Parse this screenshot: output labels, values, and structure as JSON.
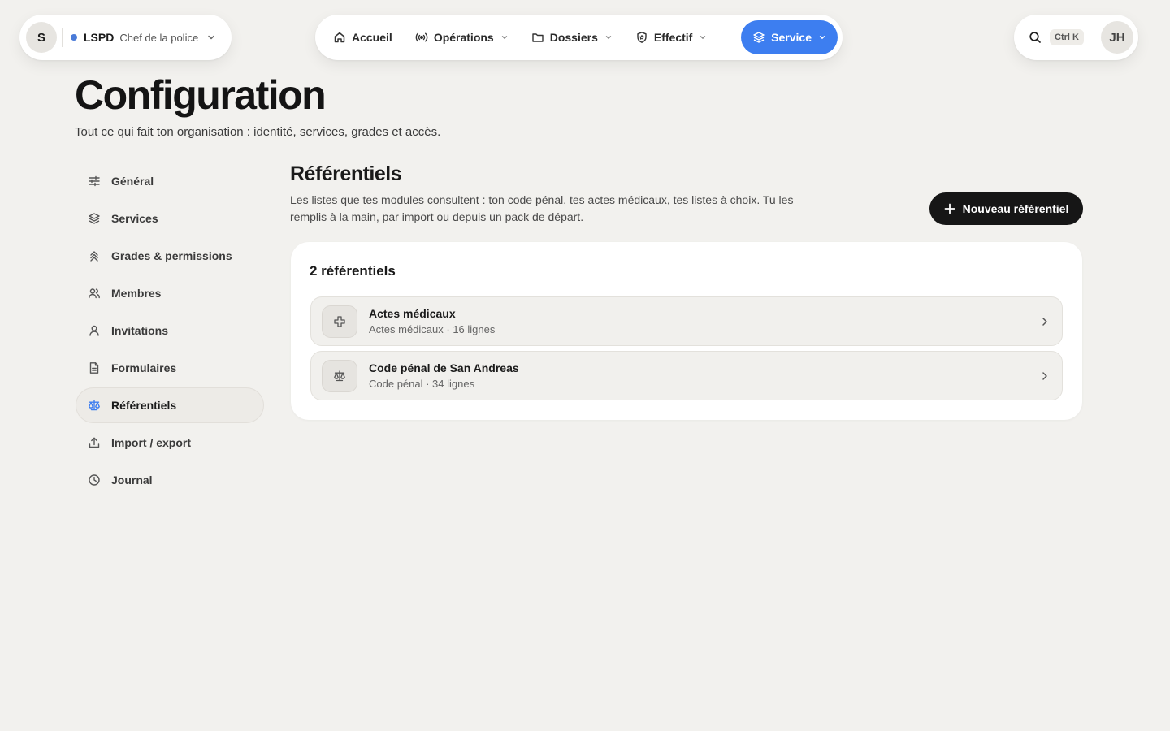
{
  "org": {
    "avatar_initial": "S",
    "name": "LSPD",
    "role": "Chef de la police",
    "status_color": "#4a7bd8"
  },
  "nav": {
    "items": [
      {
        "label": "Accueil",
        "icon": "home-icon"
      },
      {
        "label": "Opérations",
        "icon": "broadcast-icon"
      },
      {
        "label": "Dossiers",
        "icon": "folder-icon"
      },
      {
        "label": "Effectif",
        "icon": "shield-icon"
      },
      {
        "label": "Service",
        "icon": "layers-icon",
        "active": true
      }
    ],
    "active_color": "#3d7ef0"
  },
  "user": {
    "search_icon": "search-icon",
    "shortcut": "Ctrl K",
    "initials": "JH"
  },
  "header": {
    "title": "Configuration",
    "subtitle": "Tout ce qui fait ton organisation : identité, services, grades et accès."
  },
  "sidebar": {
    "items": [
      {
        "label": "Général",
        "icon": "sliders-icon"
      },
      {
        "label": "Services",
        "icon": "layers-icon"
      },
      {
        "label": "Grades & permissions",
        "icon": "chevrons-up-icon"
      },
      {
        "label": "Membres",
        "icon": "users-icon"
      },
      {
        "label": "Invitations",
        "icon": "user-icon"
      },
      {
        "label": "Formulaires",
        "icon": "file-text-icon"
      },
      {
        "label": "Référentiels",
        "icon": "scale-icon",
        "active": true
      },
      {
        "label": "Import / export",
        "icon": "upload-icon"
      },
      {
        "label": "Journal",
        "icon": "clock-icon"
      }
    ]
  },
  "main": {
    "title": "Référentiels",
    "description": "Les listes que tes modules consultent : ton code pénal, tes actes médicaux, tes listes à choix. Tu les remplis à la main, par import ou depuis un pack de départ.",
    "new_button_label": "Nouveau référentiel",
    "count_label": "2 référentiels",
    "referentials": [
      {
        "name": "Actes médicaux",
        "meta": "Actes médicaux · 16 lignes",
        "icon": "medical-cross-icon"
      },
      {
        "name": "Code pénal de San Andreas",
        "meta": "Code pénal · 34 lignes",
        "icon": "scale-icon"
      }
    ]
  }
}
